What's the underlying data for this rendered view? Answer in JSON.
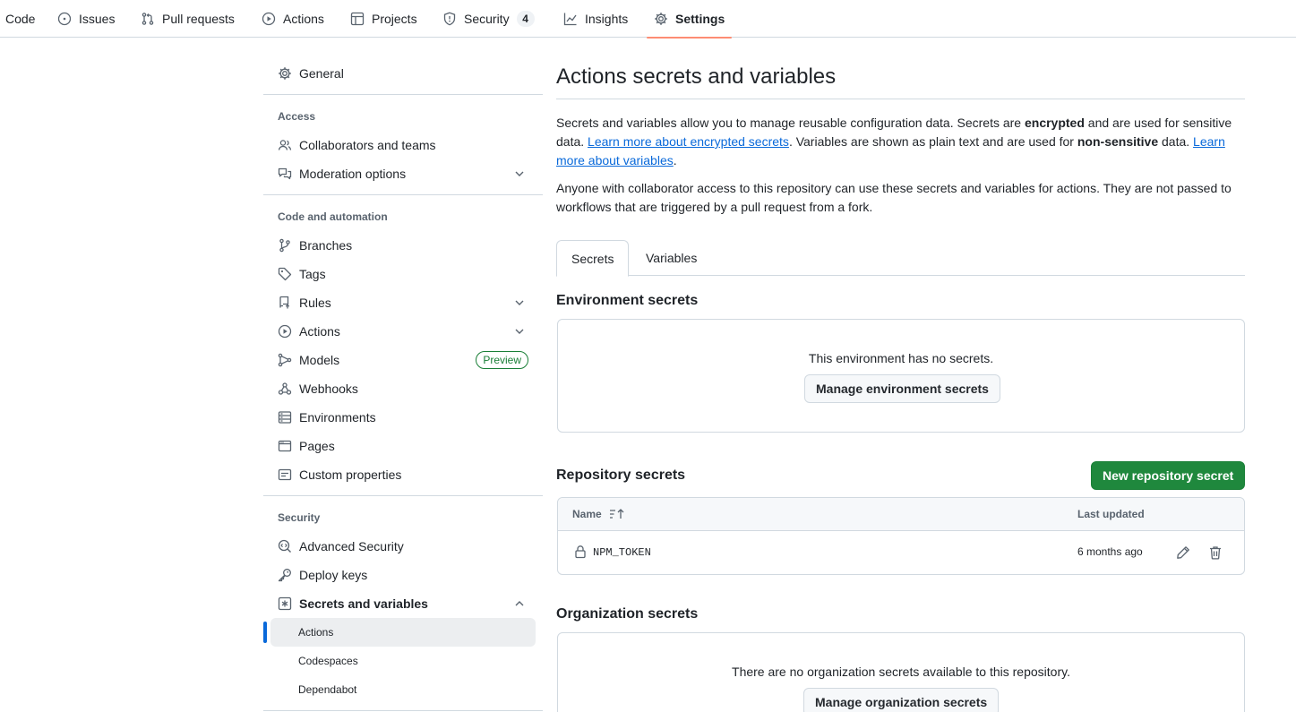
{
  "topnav": {
    "tabs": [
      {
        "label": "Code",
        "icon": "code-icon"
      },
      {
        "label": "Issues",
        "icon": "issue-opened-icon"
      },
      {
        "label": "Pull requests",
        "icon": "git-pull-request-icon"
      },
      {
        "label": "Actions",
        "icon": "play-icon"
      },
      {
        "label": "Projects",
        "icon": "table-icon"
      },
      {
        "label": "Security",
        "icon": "shield-icon",
        "count": "4"
      },
      {
        "label": "Insights",
        "icon": "graph-icon"
      },
      {
        "label": "Settings",
        "icon": "gear-icon",
        "active": true
      }
    ]
  },
  "sidebar": {
    "general": "General",
    "access_heading": "Access",
    "collaborators": "Collaborators and teams",
    "moderation": "Moderation options",
    "code_heading": "Code and automation",
    "branches": "Branches",
    "tags": "Tags",
    "rules": "Rules",
    "actions": "Actions",
    "models": "Models",
    "models_badge": "Preview",
    "webhooks": "Webhooks",
    "environments": "Environments",
    "pages": "Pages",
    "custom_properties": "Custom properties",
    "security_heading": "Security",
    "advanced_security": "Advanced Security",
    "deploy_keys": "Deploy keys",
    "secrets_variables": "Secrets and variables",
    "sub_actions": "Actions",
    "sub_codespaces": "Codespaces",
    "sub_dependabot": "Dependabot"
  },
  "main": {
    "title": "Actions secrets and variables",
    "desc1_a": "Secrets and variables allow you to manage reusable configuration data. Secrets are ",
    "desc1_b": "encrypted",
    "desc1_c": " and are used for sensitive data. ",
    "desc1_link1": "Learn more about encrypted secrets",
    "desc1_d": ". Variables are shown as plain text and are used for ",
    "desc1_e": "non-sensitive",
    "desc1_f": " data. ",
    "desc1_link2": "Learn more about variables",
    "desc1_g": ".",
    "desc2": "Anyone with collaborator access to this repository can use these secrets and variables for actions. They are not passed to workflows that are triggered by a pull request from a fork.",
    "tab_secrets": "Secrets",
    "tab_variables": "Variables",
    "env_title": "Environment secrets",
    "env_empty": "This environment has no secrets.",
    "env_button": "Manage environment secrets",
    "repo_title": "Repository secrets",
    "repo_new_button": "New repository secret",
    "table_name_header": "Name",
    "table_updated_header": "Last updated",
    "secret_rows": [
      {
        "name": "NPM_TOKEN",
        "updated": "6 months ago"
      }
    ],
    "org_title": "Organization secrets",
    "org_empty": "There are no organization secrets available to this repository.",
    "org_button": "Manage organization secrets"
  },
  "colors": {
    "accent_blue": "#0969da",
    "primary_green": "#1f883d",
    "tab_underline": "#fd8c73"
  }
}
